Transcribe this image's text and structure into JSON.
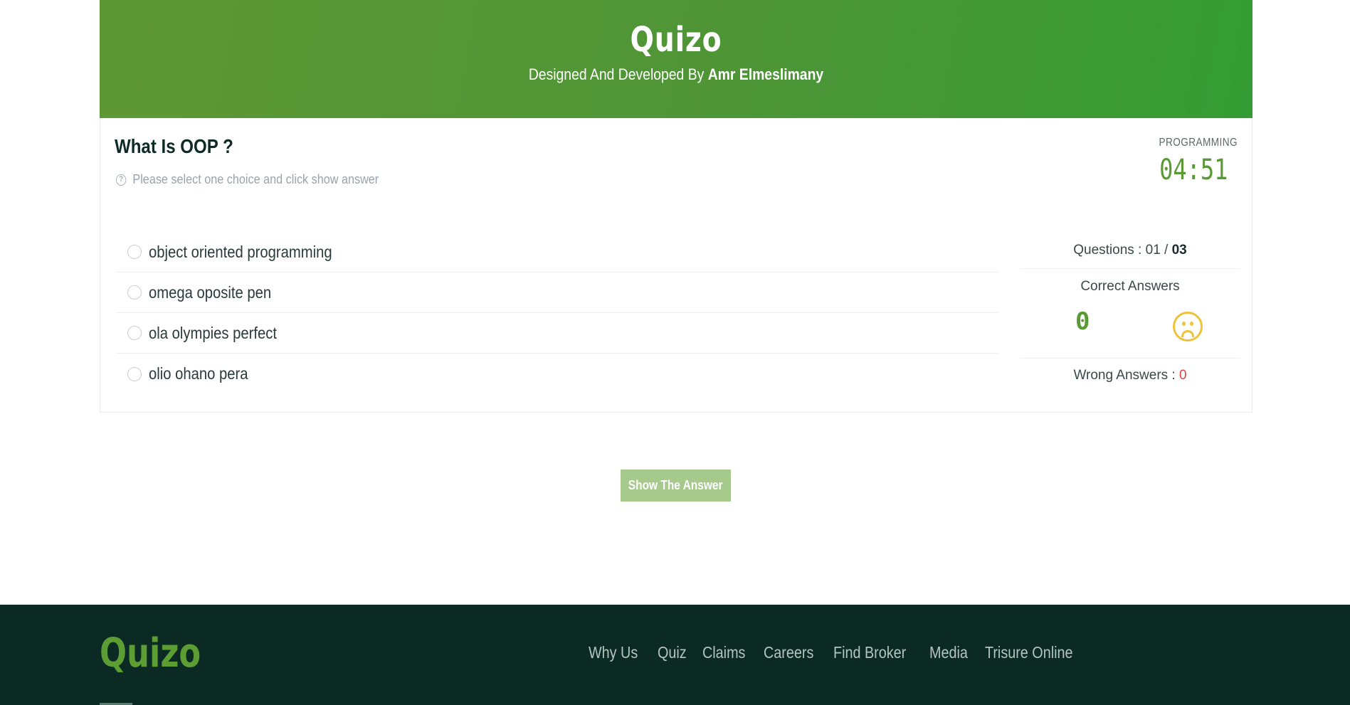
{
  "header": {
    "brand": "Quizo",
    "credit_prefix": "Designed And Developed By",
    "credit_name": "Amr Elmeslimany",
    "background_colors": [
      "#5e9834",
      "#349c34"
    ]
  },
  "question": {
    "title": "What Is OOP ?",
    "hint": "Please select one choice and click show answer",
    "hint_icon": "help-circle-icon",
    "category": "PROGRAMMING",
    "timer": "04:51",
    "choices": [
      "object oriented programming",
      "omega oposite pen",
      "ola olympies perfect",
      "olio ohano pera"
    ]
  },
  "stats": {
    "questions_label": "Questions :",
    "current": "01",
    "separator": "/",
    "total": "03",
    "correct_label": "Correct Answers",
    "correct_count": "0",
    "mood_icon": "sad-face-icon",
    "wrong_label": "Wrong Answers :",
    "wrong_count": "0"
  },
  "actions": {
    "show_answer": "Show The Answer"
  },
  "footer": {
    "logo": "Quizo",
    "nav": [
      "Why Us",
      "Quiz",
      "Claims",
      "Careers",
      "Find Broker",
      "Media",
      "Trisure Online"
    ]
  },
  "colors": {
    "accent": "#5a9a34",
    "button": "#a6c98c",
    "footer_bg": "#0b2a24",
    "wrong": "#e04343",
    "mood": "#f0c23a"
  }
}
